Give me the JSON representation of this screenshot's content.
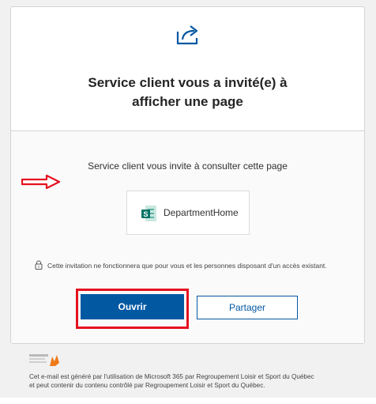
{
  "header": {
    "title_line1": "Service client vous a invité(e) à",
    "title_line2": "afficher une page",
    "icon": "share-arrow-icon"
  },
  "invite": {
    "text": "Service client vous invite à consulter cette page"
  },
  "document": {
    "name": "DepartmentHome",
    "icon": "sharepoint-page-icon"
  },
  "notice": {
    "text": "Cette invitation ne fonctionnera que pour vous et les personnes disposant d'un accès existant.",
    "icon": "lock-icon"
  },
  "actions": {
    "open_label": "Ouvrir",
    "share_label": "Partager"
  },
  "footer": {
    "line1": "Cet e-mail est généré par l'utilisation de Microsoft 365 par Regroupement Loisir et Sport du Québec",
    "line2": "et peut contenir du contenu contrôlé par Regroupement Loisir et Sport du Québec.",
    "logo": "organization-logo"
  },
  "colors": {
    "accent": "#0358a2",
    "highlight": "#e5121f",
    "sharepoint_green": "#077568"
  }
}
